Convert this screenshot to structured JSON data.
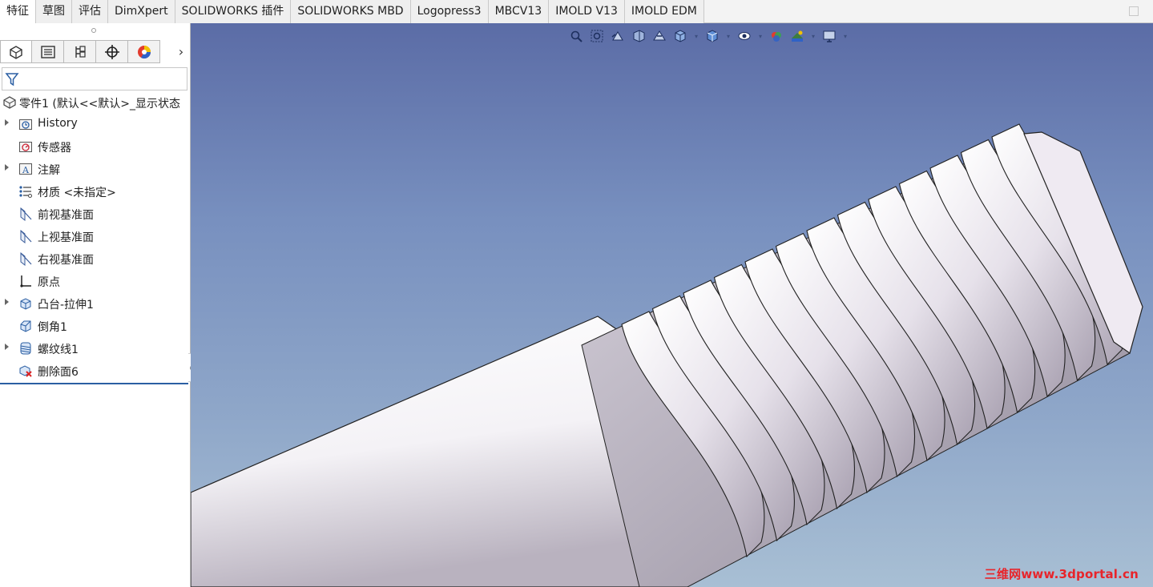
{
  "tabs": [
    "特征",
    "草图",
    "评估",
    "DimXpert",
    "SOLIDWORKS 插件",
    "SOLIDWORKS MBD",
    "Logopress3",
    "MBCV13",
    "IMOLD V13",
    "IMOLD EDM"
  ],
  "active_tab": "特征",
  "manager_tabs": [
    "featuremanager-icon",
    "propertymanager-icon",
    "configurationmanager-icon",
    "dimxpert-icon",
    "display-manager-icon"
  ],
  "tree": {
    "root_label": "零件1 (默认<<默认>_显示状态",
    "items": [
      {
        "label": "History",
        "icon": "history-folder-icon",
        "expandable": true
      },
      {
        "label": "传感器",
        "icon": "sensor-icon",
        "expandable": false
      },
      {
        "label": "注解",
        "icon": "annotations-icon",
        "expandable": true
      },
      {
        "label": "材质 <未指定>",
        "icon": "material-icon",
        "expandable": false
      },
      {
        "label": "前视基准面",
        "icon": "plane-icon",
        "expandable": false
      },
      {
        "label": "上视基准面",
        "icon": "plane-icon",
        "expandable": false
      },
      {
        "label": "右视基准面",
        "icon": "plane-icon",
        "expandable": false
      },
      {
        "label": "原点",
        "icon": "origin-icon",
        "expandable": false
      },
      {
        "label": "凸台-拉伸1",
        "icon": "boss-extrude-icon",
        "expandable": true
      },
      {
        "label": "倒角1",
        "icon": "chamfer-icon",
        "expandable": false
      },
      {
        "label": "螺纹线1",
        "icon": "thread-icon",
        "expandable": true
      },
      {
        "label": "删除面6",
        "icon": "delete-face-icon",
        "expandable": false
      }
    ]
  },
  "heads_up_toolbar": [
    "zoom-to-fit-icon",
    "zoom-to-area-icon",
    "previous-view-icon",
    "section-view-icon",
    "dynamic-annotation-icon",
    "view-orientation-icon",
    "display-style-icon",
    "hide-show-icon",
    "edit-appearance-icon",
    "apply-scene-icon",
    "view-settings-icon"
  ],
  "watermark": "三维网www.3dportal.cn",
  "colors": {
    "accent": "#2b5fa3",
    "viewport_top": "#5b6ca6",
    "viewport_bottom": "#a8bfd4",
    "part": "#e9e3ec",
    "watermark": "#e8242a"
  }
}
